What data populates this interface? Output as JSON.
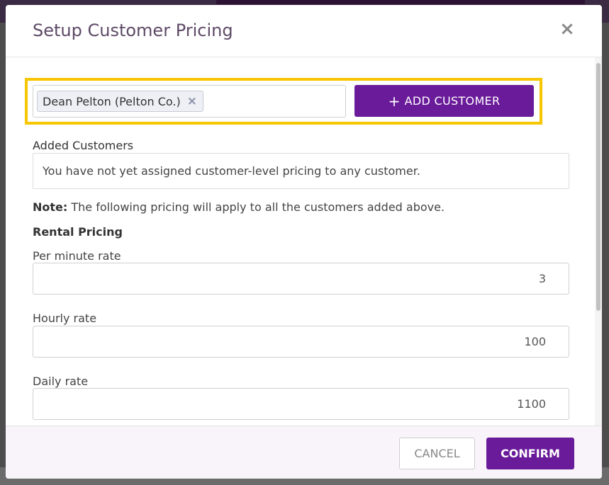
{
  "modal": {
    "title": "Setup Customer Pricing",
    "close_symbol": "×"
  },
  "customer_select": {
    "selected_tag": "Dean Pelton (Pelton Co.)",
    "remove_symbol": "×",
    "add_button_icon": "+",
    "add_button_label": "ADD CUSTOMER",
    "highlight_color": "#f7c600"
  },
  "added_customers": {
    "label": "Added Customers",
    "empty_message": "You have not yet assigned customer-level pricing to any customer."
  },
  "note": {
    "prefix": "Note:",
    "text": "The following pricing will apply to all the customers added above."
  },
  "rental_pricing": {
    "heading": "Rental Pricing",
    "fields": [
      {
        "label": "Per minute rate",
        "value": "3"
      },
      {
        "label": "Hourly rate",
        "value": "100"
      },
      {
        "label": "Daily rate",
        "value": "1100"
      }
    ]
  },
  "footer": {
    "cancel_label": "CANCEL",
    "confirm_label": "CONFIRM"
  },
  "colors": {
    "primary": "#6a1b9a",
    "title": "#5e4a66"
  }
}
